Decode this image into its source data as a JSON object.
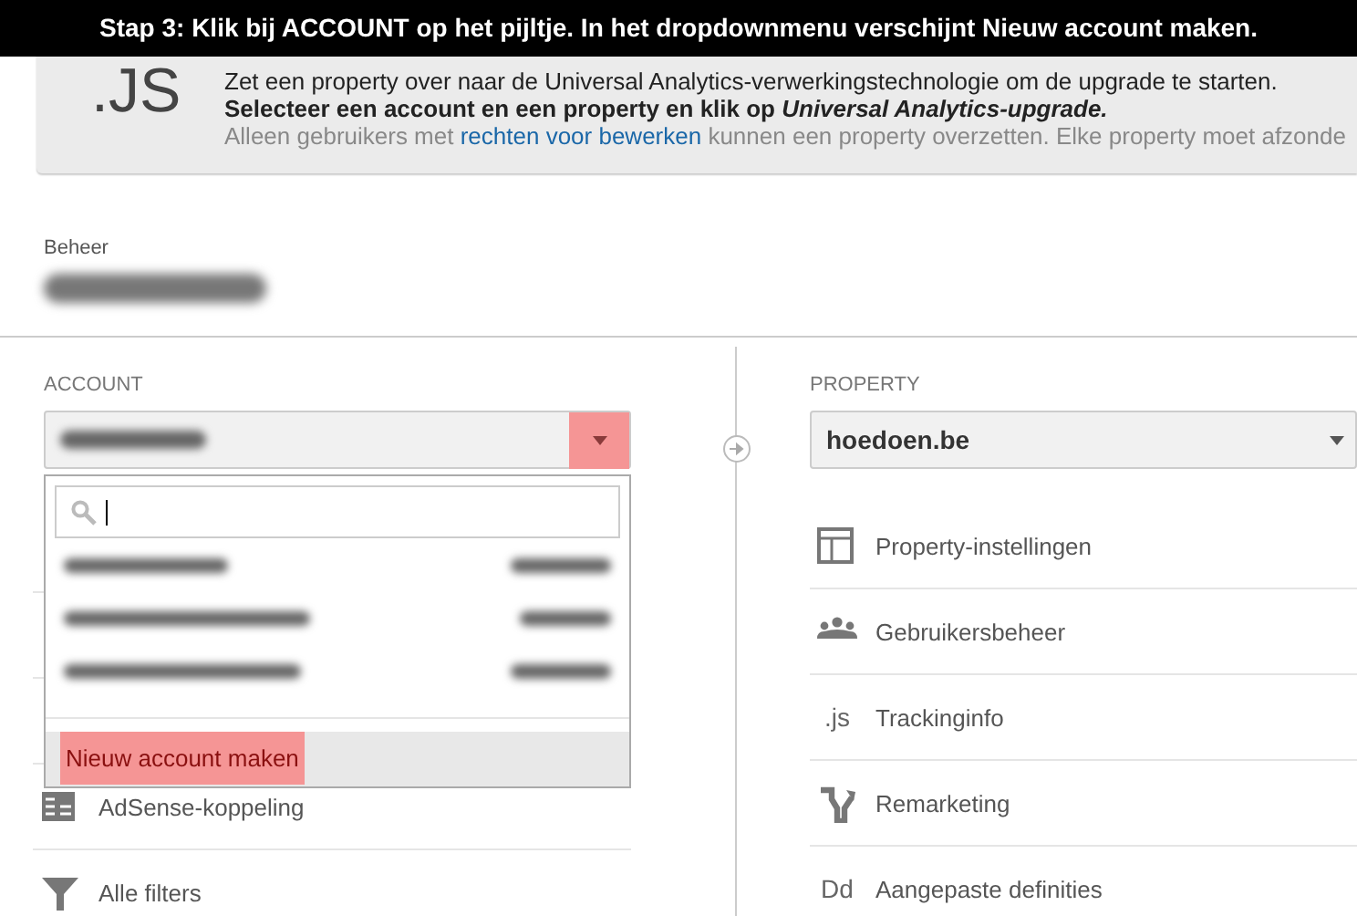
{
  "caption": "Stap 3: Klik bij ACCOUNT op het pijltje. In het dropdownmenu verschijnt Nieuw account maken.",
  "notice": {
    "icon_text": ".JS",
    "line_1": "Zet een property over naar de Universal Analytics-verwerkingstechnologie om de upgrade te starten.",
    "line_2": "Selecteer een account en een property en klik op *Universal Analytics-upgrade.*",
    "line_3": {
      "before": "Alleen gebruikers met ",
      "link": "rechten voor bewerken",
      "after": " kunnen een property overzetten. Elke property moet afzonde"
    }
  },
  "admin": {
    "label": "Beheer"
  },
  "account": {
    "label": "ACCOUNT",
    "arrow_highlighted": true,
    "dropdown_open": true,
    "create_item": {
      "label": "Nieuw account maken",
      "highlighted": true
    },
    "menu": [
      {
        "kind": "adsense",
        "label": "AdSense-koppeling"
      },
      {
        "kind": "filter",
        "label": "Alle filters"
      }
    ]
  },
  "property": {
    "label": "PROPERTY",
    "value": "hoedoen.be",
    "menu": [
      {
        "kind": "settings",
        "label": "Property-instellingen"
      },
      {
        "kind": "users",
        "label": "Gebruikersbeheer"
      },
      {
        "kind": "text",
        "icon_text": ".js",
        "label": "Trackinginfo"
      },
      {
        "kind": "remarketing",
        "label": "Remarketing"
      },
      {
        "kind": "text",
        "icon_text": "Dd",
        "label": "Aangepaste definities"
      }
    ]
  }
}
